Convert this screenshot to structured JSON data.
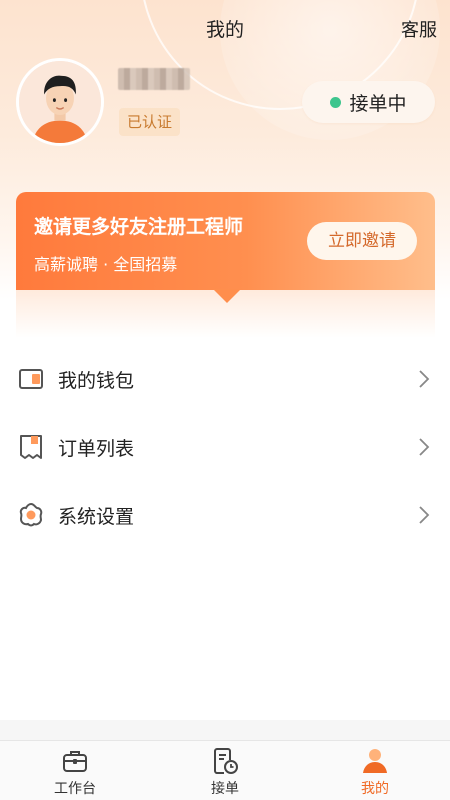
{
  "header": {
    "title": "我的",
    "service_label": "客服"
  },
  "profile": {
    "name": "",
    "verified_label": "已认证",
    "status_label": "接单中",
    "status_color": "#3dc58d"
  },
  "banner": {
    "title": "邀请更多好友注册工程师",
    "subtitle": "高薪诚聘 · 全国招募",
    "button_label": "立即邀请",
    "gradient_start": "#ff7a3c",
    "gradient_end": "#ffbe8b"
  },
  "menu": {
    "items": [
      {
        "label": "我的钱包",
        "icon": "wallet-icon"
      },
      {
        "label": "订单列表",
        "icon": "order-list-icon"
      },
      {
        "label": "系统设置",
        "icon": "settings-icon"
      }
    ]
  },
  "tabbar": {
    "tabs": [
      {
        "label": "工作台",
        "icon": "briefcase-icon",
        "active": false
      },
      {
        "label": "接单",
        "icon": "receive-order-icon",
        "active": false
      },
      {
        "label": "我的",
        "icon": "profile-icon",
        "active": true
      }
    ],
    "active_color": "#f06a25"
  }
}
